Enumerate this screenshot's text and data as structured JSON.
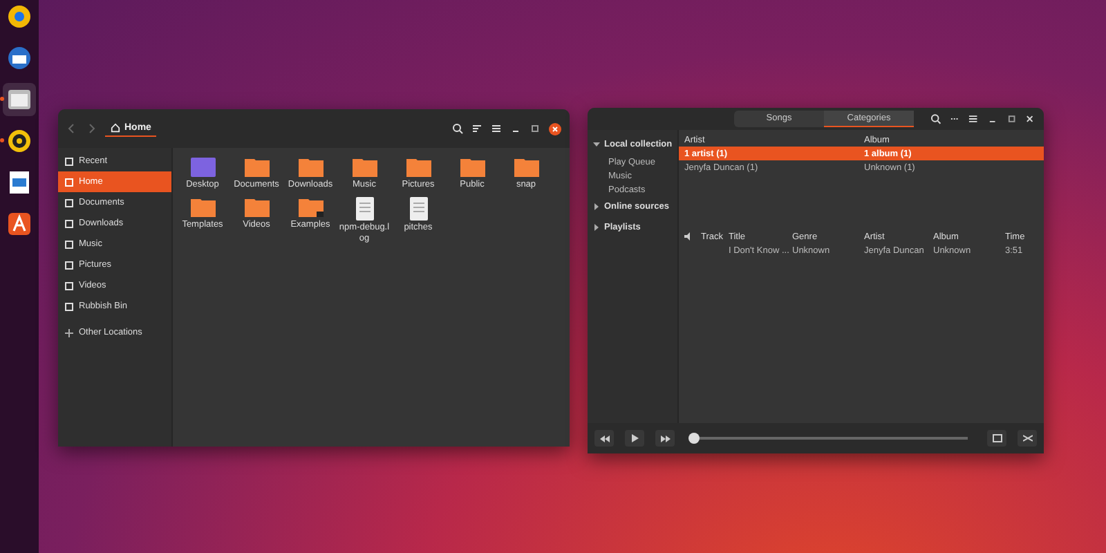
{
  "dock": [
    {
      "kind": "browser",
      "running": false
    },
    {
      "kind": "mail",
      "running": false
    },
    {
      "kind": "files",
      "running": true
    },
    {
      "kind": "music",
      "running": true
    },
    {
      "kind": "writer",
      "running": false
    },
    {
      "kind": "store",
      "running": false
    }
  ],
  "files_window": {
    "path": "Home",
    "sidebar": [
      {
        "label": "Recent",
        "selected": false
      },
      {
        "label": "Home",
        "selected": true
      },
      {
        "label": "Documents",
        "selected": false
      },
      {
        "label": "Downloads",
        "selected": false
      },
      {
        "label": "Music",
        "selected": false
      },
      {
        "label": "Pictures",
        "selected": false
      },
      {
        "label": "Videos",
        "selected": false
      },
      {
        "label": "Rubbish Bin",
        "selected": false
      }
    ],
    "other_locations": "Other Locations",
    "items": [
      {
        "name": "Desktop",
        "kind": "desktop"
      },
      {
        "name": "Documents",
        "kind": "folder"
      },
      {
        "name": "Downloads",
        "kind": "folder"
      },
      {
        "name": "Music",
        "kind": "folder"
      },
      {
        "name": "Pictures",
        "kind": "folder"
      },
      {
        "name": "Public",
        "kind": "folder"
      },
      {
        "name": "snap",
        "kind": "folder"
      },
      {
        "name": "Templates",
        "kind": "folder"
      },
      {
        "name": "Videos",
        "kind": "folder"
      },
      {
        "name": "Examples",
        "kind": "link"
      },
      {
        "name": "npm-debug.log",
        "kind": "file"
      },
      {
        "name": "pitches",
        "kind": "file"
      }
    ]
  },
  "music_window": {
    "tabs": [
      {
        "label": "Songs",
        "selected": false
      },
      {
        "label": "Categories",
        "selected": true
      }
    ],
    "sources": [
      {
        "label": "Local collection",
        "expanded": true,
        "children": [
          {
            "label": "Play Queue"
          },
          {
            "label": "Music"
          },
          {
            "label": "Podcasts"
          }
        ]
      },
      {
        "label": "Online sources",
        "expanded": false
      },
      {
        "label": "Playlists",
        "expanded": false
      }
    ],
    "categories": {
      "columns": [
        "Artist",
        "Album"
      ],
      "rows": [
        {
          "cells": [
            "1 artist (1)",
            "1 album (1)"
          ],
          "selected": true
        },
        {
          "cells": [
            "Jenyfa Duncan (1)",
            "Unknown (1)"
          ],
          "selected": false
        }
      ]
    },
    "tracks": {
      "columns": [
        "Track",
        "Title",
        "Genre",
        "Artist",
        "Album",
        "Time"
      ],
      "rows": [
        {
          "title": "I Don't Know ...",
          "genre": "Unknown",
          "artist": "Jenyfa Duncan",
          "album": "Unknown",
          "time": "3:51"
        }
      ]
    },
    "progress": {
      "level": 0
    }
  }
}
